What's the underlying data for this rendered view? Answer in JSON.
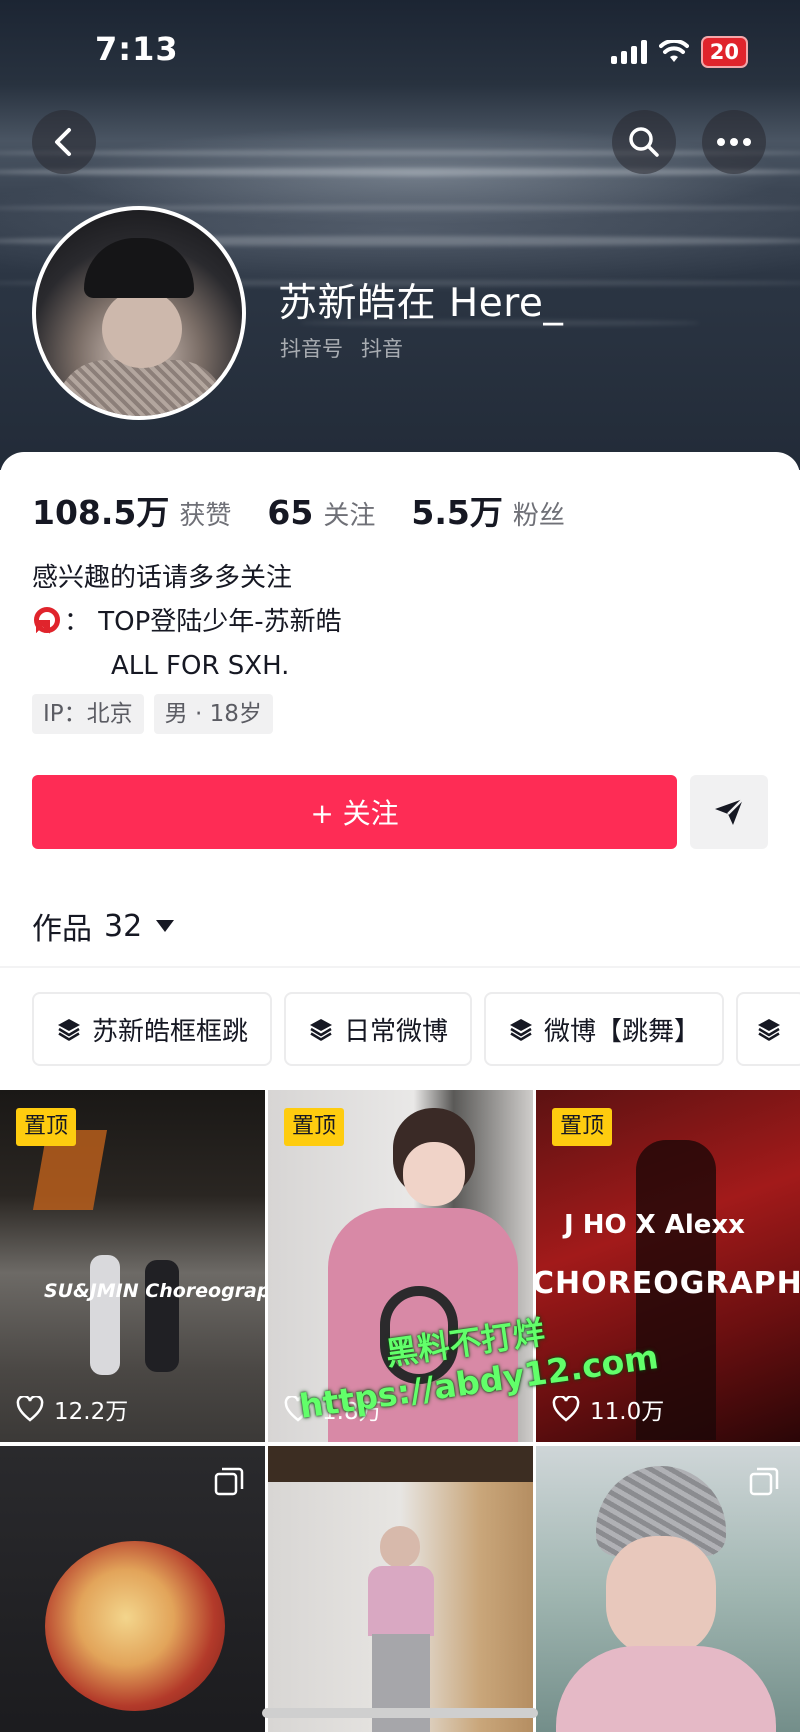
{
  "status_bar": {
    "time": "7:13",
    "battery": "20"
  },
  "profile": {
    "name": "苏新皓在 Here_",
    "id_label": "抖音号",
    "id_value": "抖音"
  },
  "stats": [
    {
      "value": "108.5万",
      "label": "获赞"
    },
    {
      "value": "65",
      "label": "关注"
    },
    {
      "value": "5.5万",
      "label": "粉丝"
    }
  ],
  "bio": {
    "line1": "感兴趣的话请多多关注",
    "line2": "：  TOP登陆少年-苏新皓",
    "line3": "ALL FOR SXH."
  },
  "tags": [
    "IP：北京",
    "男 · 18岁"
  ],
  "actions": {
    "follow_label": "+ 关注"
  },
  "works": {
    "label": "作品",
    "count": "32"
  },
  "collections": [
    "苏新皓框框跳",
    "日常微博",
    "微博【跳舞】"
  ],
  "videos": [
    {
      "pinned_label": "置顶",
      "likes": "12.2万",
      "overlay": "SU&JMIN Choreography"
    },
    {
      "pinned_label": "置顶",
      "likes": "1.8万"
    },
    {
      "pinned_label": "置顶",
      "likes": "11.0万",
      "overlay_line1": "J HO X Alexx",
      "overlay_line2": "CHOREOGRAPHY"
    },
    {
      "multi": true
    },
    {
      "multi": false
    },
    {
      "multi": true
    }
  ],
  "watermark": {
    "line1": "黑料不打烊",
    "line2": "https://abdy12.com"
  },
  "colors": {
    "accent": "#fe2c55",
    "pin": "#fecc0f",
    "text": "#161823",
    "muted": "#6f7077"
  }
}
